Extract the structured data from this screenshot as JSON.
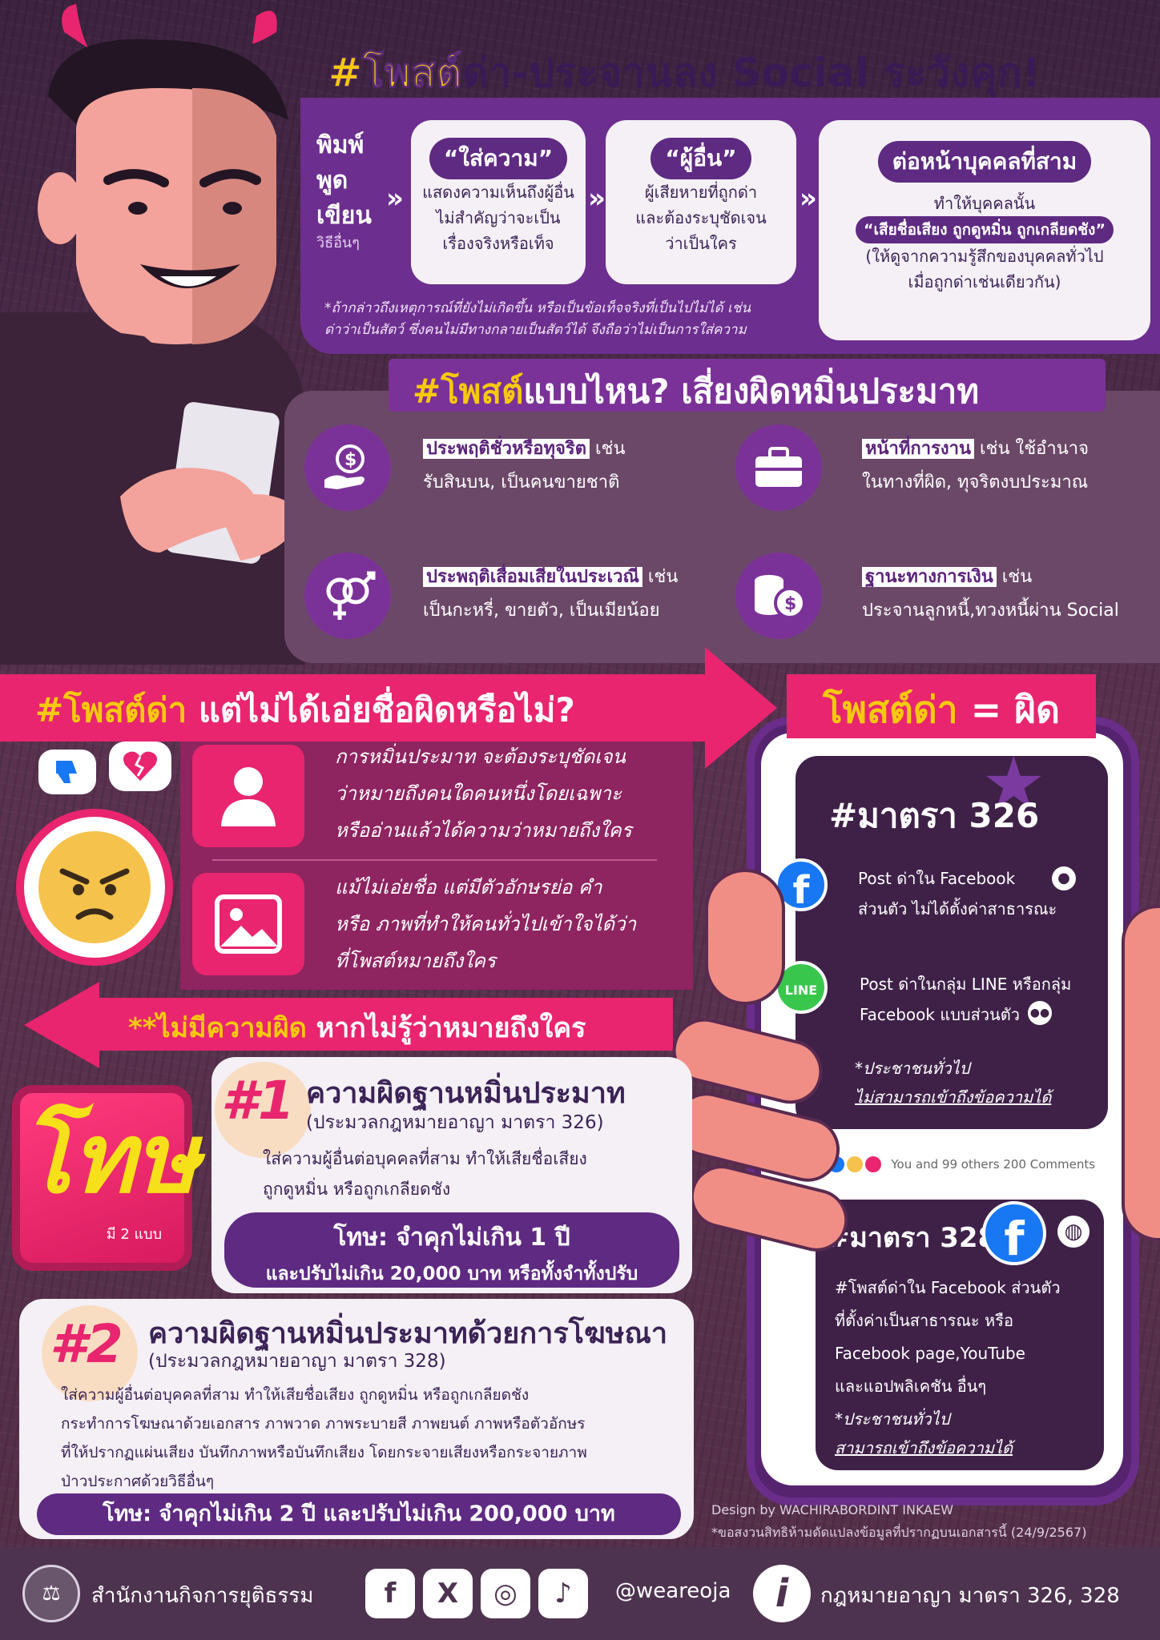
{
  "title": {
    "hashtag": "#โพสต์",
    "rest": "ด่า-ประจานลง Social ระวังคุก!"
  },
  "verbs": {
    "v1": "พิมพ์",
    "v2": "พูด",
    "v3": "เขียน",
    "v4": "วิธีอื่นๆ"
  },
  "cards": {
    "c1": {
      "pill": "“ใส่ความ”",
      "l1": "แสดงความเห็นถึงผู้อื่น",
      "l2": "ไม่สำคัญว่าจะเป็น",
      "l3": "เรื่องจริงหรือเท็จ"
    },
    "c2": {
      "pill": "“ผู้อื่น”",
      "l1": "ผู้เสียหายที่ถูกด่า",
      "l2": "และต้องระบุชัดเจน",
      "l3": "ว่าเป็นใคร"
    },
    "c3": {
      "pill": "ต่อหน้าบุคคลที่สาม",
      "l1": "ทำให้บุคคลนั้น",
      "pill2": "“เสียชื่อเสียง ถูกดูหมิ่น ถูกเกลียดชัง”",
      "l2": "(ให้ดูจากความรู้สึกของบุคคลทั่วไป",
      "l3": "เมื่อถูกด่าเช่นเดียวกัน)"
    }
  },
  "note": {
    "l1": "*ถ้ากล่าวถึงเหตุการณ์ที่ยังไม่เกิดขึ้น หรือเป็นข้อเท็จจริงที่เป็นไปไม่ได้ เช่น",
    "l2": "ด่าว่าเป็นสัตว์ ซึ่งคนไม่มีทางกลายเป็นสัตว์ได้ จึงถือว่าไม่เป็นการใส่ความ"
  },
  "risk": {
    "hashtag": "#โพสต์",
    "title": "แบบไหน? เสี่ยงผิดหมิ่นประมาท",
    "items": [
      {
        "head": "ประพฤติชั่วหรือทุจริต",
        "tail": " เช่น",
        "l2": "รับสินบน, เป็นคนขายชาติ"
      },
      {
        "head": "หน้าที่การงาน",
        "tail": " เช่น ใช้อำนาจ",
        "l2": "ในทางที่ผิด, ทุจริตงบประมาณ"
      },
      {
        "head": "ประพฤติเสื่อมเสียในประเวณี",
        "tail": " เช่น",
        "l2": "เป็นกะหรี่, ขายตัว, เป็นเมียน้อย"
      },
      {
        "head": "ฐานะทางการเงิน",
        "tail": " เช่น",
        "l2": "ประจานลูกหนี้,ทวงหนี้ผ่าน Social"
      }
    ]
  },
  "mid": {
    "hashtag": "#โพสต์ด่า",
    "rest": " แต่ไม่ได้เอ่ยชื่อผิดหรือไม่?",
    "t1": {
      "l1": "การหมิ่นประมาท จะต้องระบุชัดเจน",
      "l2": "ว่าหมายถึงคนใดคนหนึ่งโดยเฉพาะ",
      "l3": "หรืออ่านแล้วได้ความว่าหมายถึงใคร"
    },
    "t2": {
      "l1": "แม้ไม่เอ่ยชื่อ แต่มีตัวอักษรย่อ คำ",
      "l2": "หรือ ภาพที่ทำให้คนทั่วไปเข้าใจได้ว่า",
      "l3": "ที่โพสต์หมายถึงใคร"
    }
  },
  "bottom_banner": {
    "hl": "**ไม่มีความผิด",
    "rest": " หากไม่รู้ว่าหมายถึงใคร"
  },
  "phone": {
    "head": "โพสต์ด่า",
    "eq": " = ผิด",
    "s326": {
      "title": "#มาตรา 326",
      "i1": {
        "l1": "Post ด่าใน Facebook",
        "l2": "ส่วนตัว ไม่ได้ตั้งค่าสาธารณะ"
      },
      "i2": {
        "l1": "Post ด่าในกลุ่ม LINE หรือกลุ่ม",
        "l2": "Facebook แบบส่วนตัว"
      },
      "line_label": "LINE",
      "n1": "*ประชาชนทั่วไป",
      "n2": "ไม่สามารถเข้าถึงข้อความได้"
    },
    "reactions": "You and 99 others 200 Comments",
    "s328": {
      "title": "#มาตรา 328",
      "l1": "#โพสต์ด่าใน Facebook ส่วนตัว",
      "l2": "ที่ตั้งค่าเป็นสาธารณะ หรือ",
      "l3": "Facebook page,YouTube",
      "l4": "และแอปพลิเคชัน อื่นๆ",
      "n1": "*ประชาชนทั่วไป",
      "n2": "สามารถเข้าถึงข้อความได้"
    }
  },
  "penalty": {
    "icon_text": "โทษ",
    "icon_sub": "มี 2 แบบ",
    "p1": {
      "num": "#1",
      "head": "ความผิดฐานหมิ่นประมาท",
      "sub": "(ประมวลกฎหมายอาญา มาตรา 326)",
      "d1": "ใส่ความผู้อื่นต่อบุคคลที่สาม ทำให้เสียชื่อเสียง",
      "d2": "ถูกดูหมิ่น หรือถูกเกลียดชัง",
      "bar1": "โทษ: จำคุกไม่เกิน 1 ปี",
      "bar2": "และปรับไม่เกิน 20,000 บาท หรือทั้งจำทั้งปรับ"
    },
    "p2": {
      "num": "#2",
      "head": "ความผิดฐานหมิ่นประมาทด้วยการโฆษณา",
      "sub": "(ประมวลกฎหมายอาญา มาตรา 328)",
      "d1": "ใส่ความผู้อื่นต่อบุคคลที่สาม ทำให้เสียชื่อเสียง ถูกดูหมิ่น หรือถูกเกลียดชัง",
      "d2": "กระทำการโฆษณาด้วยเอกสาร ภาพวาด ภาพระบายสี ภาพยนต์ ภาพหรือตัวอักษร",
      "d3": "ที่ให้ปรากฏแผ่นเสียง บันทึกภาพหรือบันทึกเสียง โดยกระจายเสียงหรือกระจายภาพ",
      "d4": "ป่าวประกาศด้วยวิธีอื่นๆ",
      "bar": "โทษ: จำคุกไม่เกิน 2 ปี และปรับไม่เกิน 200,000 บาท"
    }
  },
  "credits": {
    "design": "Design by WACHIRABORDINT INKAEW",
    "rights": "*ขอสงวนสิทธิห้ามดัดแปลงข้อมูลที่ปรากฏบนเอกสารนี้ (24/9/2567)"
  },
  "footer": {
    "org": "สำนักงานกิจการยุติธรรม",
    "social": {
      "fb": "f",
      "x": "X",
      "ig": "◎",
      "tt": "♪"
    },
    "handle": "@weareoja",
    "info_icon": "i",
    "law": "กฎหมายอาญา มาตรา 326, 328"
  },
  "colors": {
    "purple": "#6c2e8f",
    "pink": "#e8256e",
    "yellow": "#f6c90e",
    "dark": "#3f2148"
  }
}
